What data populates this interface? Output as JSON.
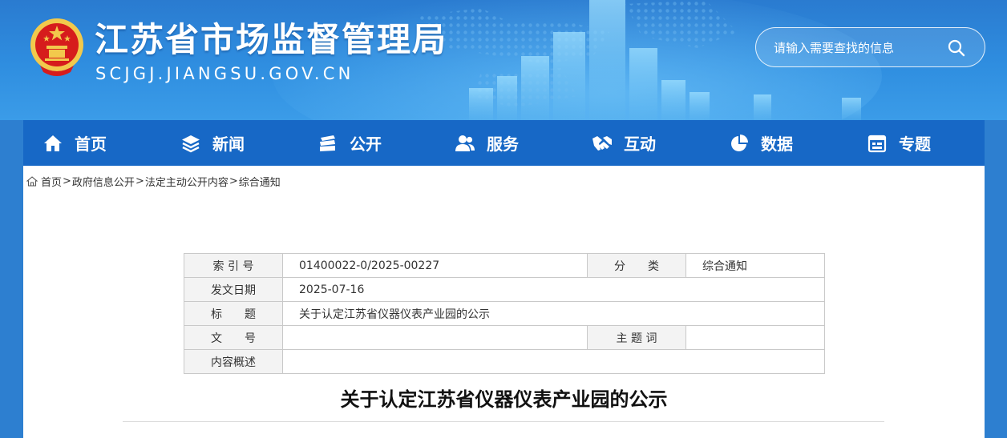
{
  "header": {
    "site_title": "江苏省市场监督管理局",
    "site_domain": "SCJGJ.JIANGSU.GOV.CN",
    "search_placeholder": "请输入需要查找的信息"
  },
  "nav": {
    "items": [
      {
        "label": "首页",
        "icon": "home-icon"
      },
      {
        "label": "新闻",
        "icon": "layers-icon"
      },
      {
        "label": "公开",
        "icon": "document-stack-icon"
      },
      {
        "label": "服务",
        "icon": "users-icon"
      },
      {
        "label": "互动",
        "icon": "handshake-icon"
      },
      {
        "label": "数据",
        "icon": "pie-chart-icon"
      },
      {
        "label": "专题",
        "icon": "calendar-icon"
      }
    ]
  },
  "breadcrumb": {
    "items": [
      "首页",
      "政府信息公开",
      "法定主动公开内容",
      "综合通知"
    ],
    "separator": ">"
  },
  "meta": {
    "index_label": "索 引 号",
    "index_value": "01400022-0/2025-00227",
    "category_label": "分　　类",
    "category_value": "综合通知",
    "date_label": "发文日期",
    "date_value": "2025-07-16",
    "title_label": "标　　题",
    "title_value": "关于认定江苏省仪器仪表产业园的公示",
    "docno_label": "文　　号",
    "docno_value": "",
    "keyword_label": "主 题 词",
    "keyword_value": "",
    "summary_label": "内容概述",
    "summary_value": ""
  },
  "article": {
    "title": "关于认定江苏省仪器仪表产业园的公示"
  },
  "colors": {
    "header_blue": "#2a7bd0",
    "nav_blue": "#1768c6",
    "table_label_bg": "#f3f3f3",
    "emblem_red": "#d61c1c",
    "emblem_gold": "#f2c94c"
  }
}
